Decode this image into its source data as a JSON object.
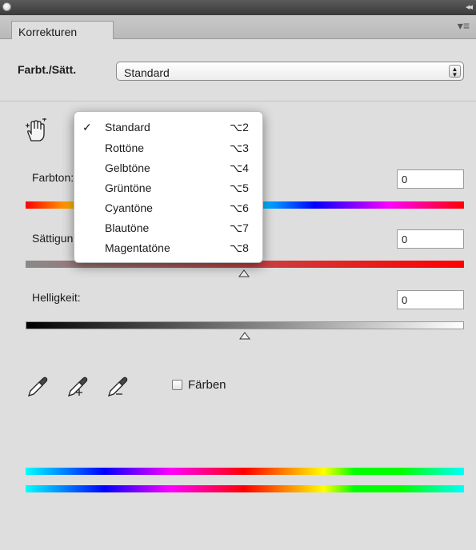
{
  "window": {
    "collapse_glyph": "◂◂"
  },
  "panel": {
    "tab_label": "Korrekturen",
    "menu_glyph": "▾≡"
  },
  "preset": {
    "label": "Farbt./Sätt.",
    "value": "Standard",
    "stepper_glyph": "▲\n▼"
  },
  "controls": {
    "hue": {
      "label": "Farbton:",
      "value": "0",
      "slider_position": 0.5
    },
    "saturation": {
      "label": "Sättigung:",
      "value": "0",
      "slider_position": 0.5
    },
    "lightness": {
      "label": "Helligkeit:",
      "value": "0",
      "slider_position": 0.5
    }
  },
  "colorize": {
    "label": "Färben",
    "checked": false
  },
  "dropdown_menu": {
    "check_glyph": "✓",
    "selected_index": 0,
    "items": [
      {
        "label": "Standard",
        "shortcut": "⌥2"
      },
      {
        "label": "Rottöne",
        "shortcut": "⌥3"
      },
      {
        "label": "Gelbtöne",
        "shortcut": "⌥4"
      },
      {
        "label": "Grüntöne",
        "shortcut": "⌥5"
      },
      {
        "label": "Cyantöne",
        "shortcut": "⌥6"
      },
      {
        "label": "Blautöne",
        "shortcut": "⌥7"
      },
      {
        "label": "Magentatöne",
        "shortcut": "⌥8"
      }
    ]
  },
  "icons": {
    "hand": "targeted-adjustment-hand-icon",
    "eyedropper": "eyedropper-icon",
    "eyedropper_add": "eyedropper-add-icon",
    "eyedropper_subtract": "eyedropper-subtract-icon"
  }
}
